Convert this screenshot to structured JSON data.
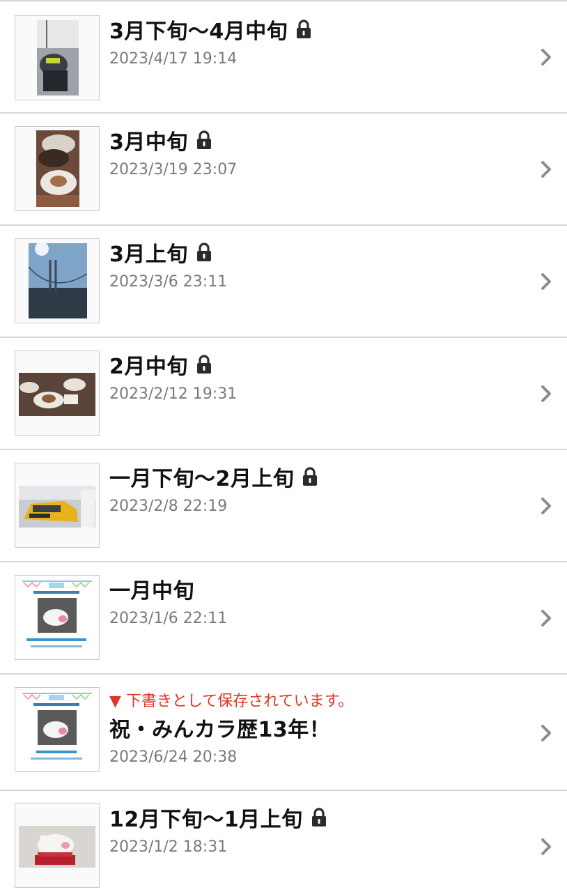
{
  "entries": [
    {
      "title": "3月下旬～4月中旬",
      "date": "2023/4/17 19:14",
      "locked": true
    },
    {
      "title": "3月中旬",
      "date": "2023/3/19 23:07",
      "locked": true
    },
    {
      "title": "3月上旬",
      "date": "2023/3/6 23:11",
      "locked": true
    },
    {
      "title": "2月中旬",
      "date": "2023/2/12 19:31",
      "locked": true
    },
    {
      "title": "一月下旬～2月上旬",
      "date": "2023/2/8 22:19",
      "locked": true
    },
    {
      "title": "一月中旬",
      "date": "2023/1/6 22:11",
      "locked": false
    },
    {
      "title": "祝・みんカラ歴13年！",
      "date": "2023/6/24 20:38",
      "locked": false,
      "draft_notice": "▼ 下書きとして保存されています。"
    },
    {
      "title": "12月下旬～1月上旬",
      "date": "2023/1/2 18:31",
      "locked": true
    }
  ],
  "icons": {
    "lock": "lock-icon",
    "chevron": "chevron-right-icon"
  },
  "colors": {
    "draft_notice": "#e0352b",
    "date": "#7a7a7a",
    "title": "#111111",
    "divider": "#d6d6d6"
  }
}
